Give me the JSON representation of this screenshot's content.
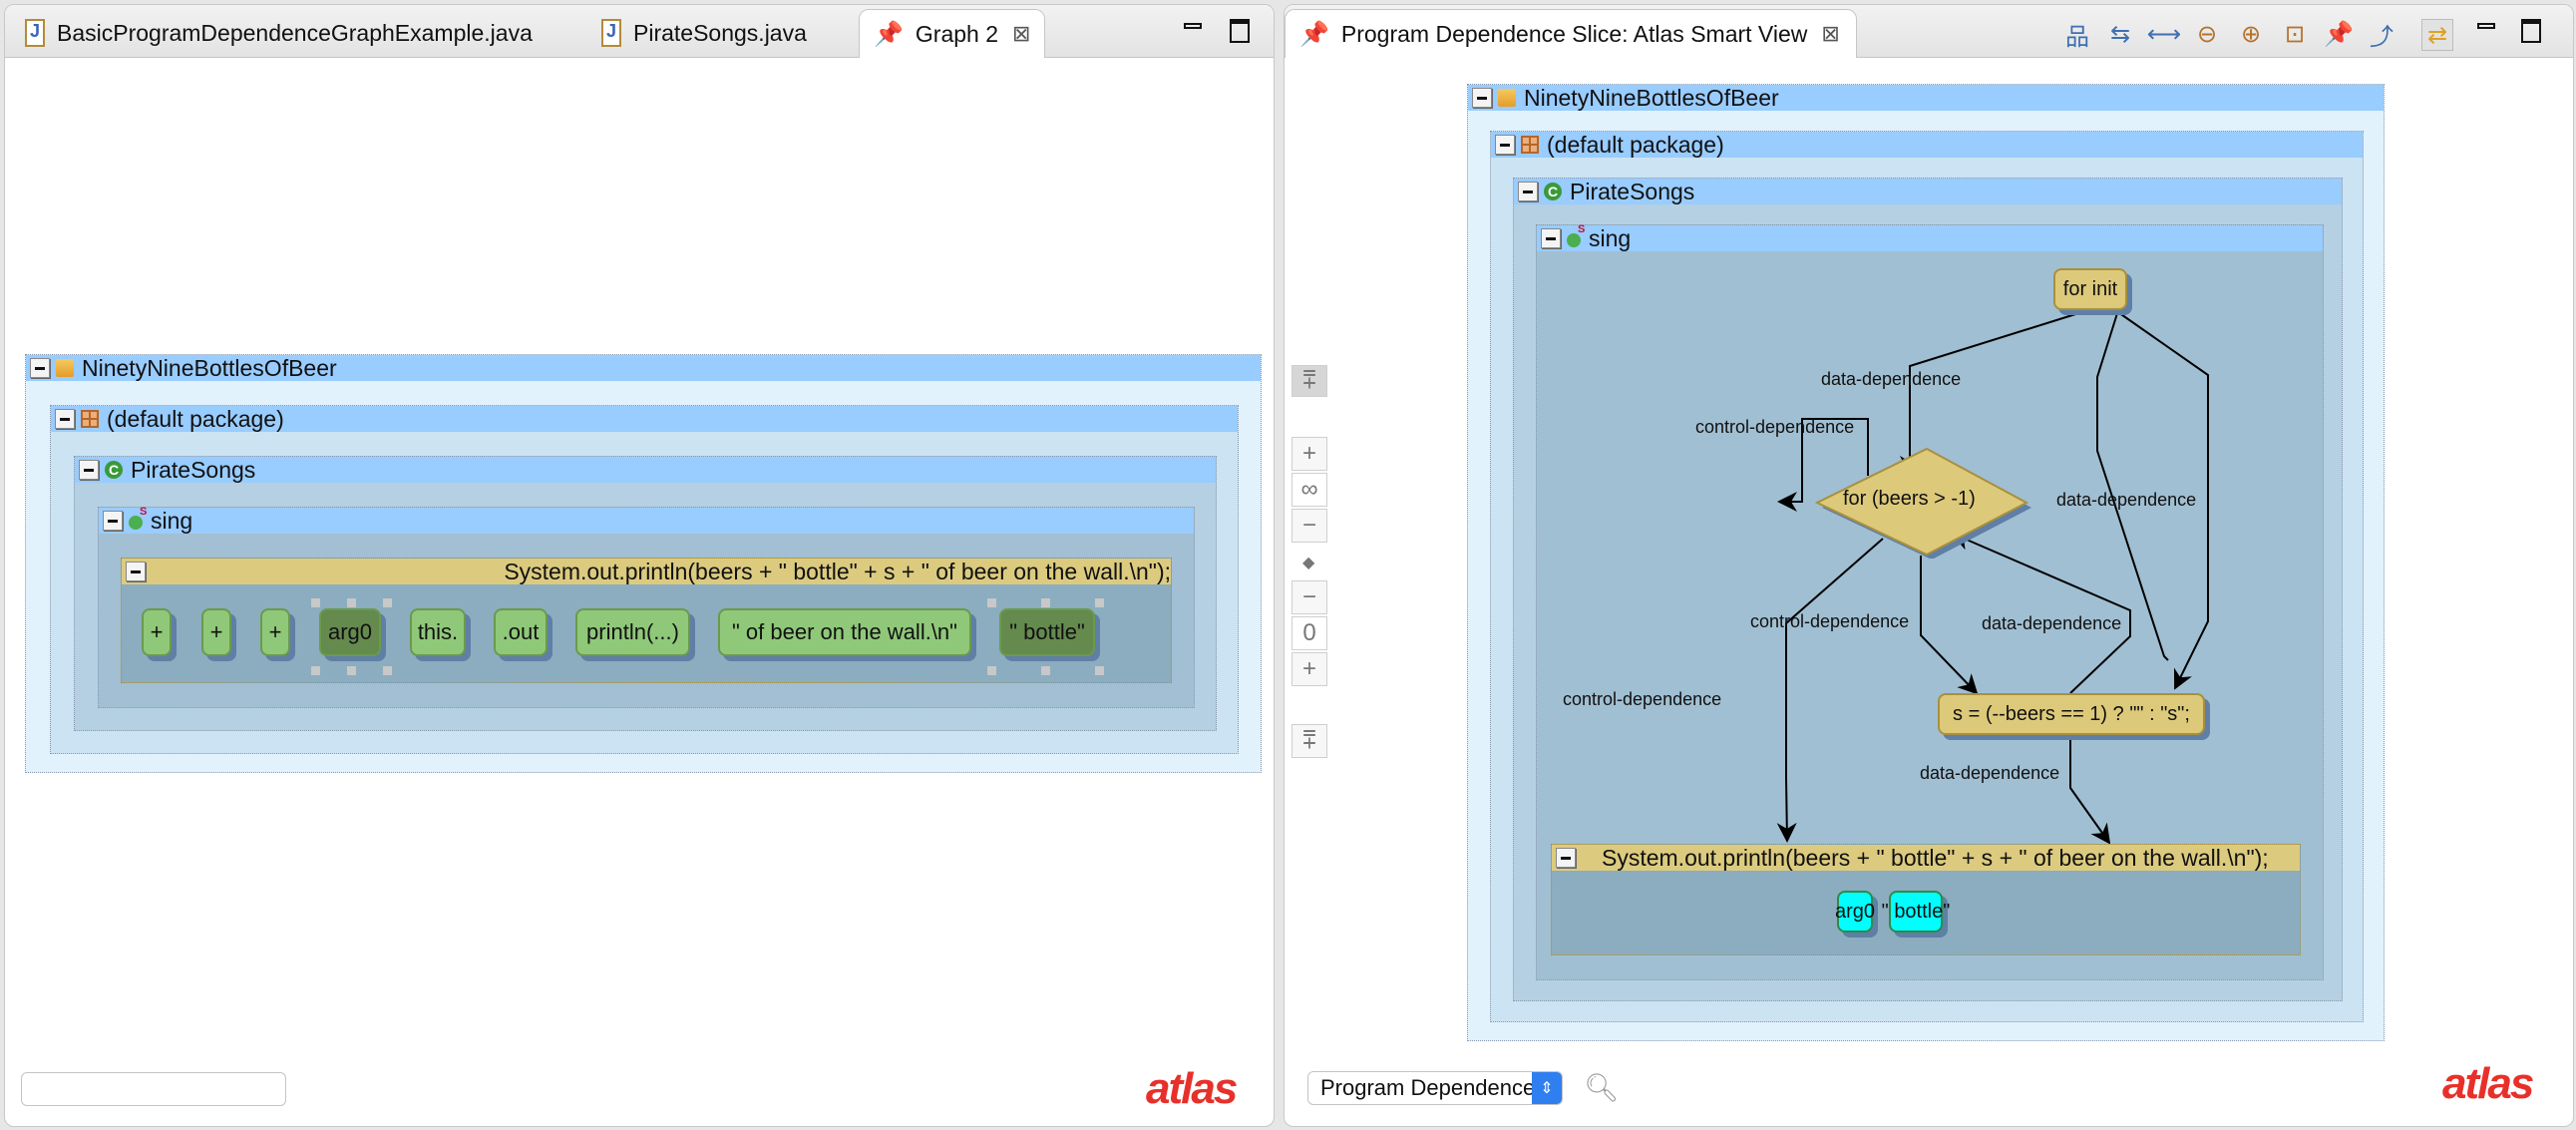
{
  "left_editor": {
    "tabs": [
      {
        "label": "BasicProgramDependenceGraphExample.java",
        "icon": "java-file-icon",
        "active": false
      },
      {
        "label": "PirateSongs.java",
        "icon": "java-file-icon",
        "active": false
      },
      {
        "label": "Graph 2",
        "icon": "pin-icon",
        "active": true,
        "closable": true
      }
    ],
    "graph": {
      "project": "NinetyNineBottlesOfBeer",
      "package": "(default package)",
      "class": "PirateSongs",
      "method": "sing",
      "statement": "System.out.println(beers + \" bottle\" + s + \" of beer on the wall.\\n\");",
      "nodes": [
        {
          "label": "+",
          "style": "light"
        },
        {
          "label": "+",
          "style": "light"
        },
        {
          "label": "+",
          "style": "light"
        },
        {
          "label": "arg0",
          "style": "dark",
          "selected": true
        },
        {
          "label": "this.",
          "style": "light"
        },
        {
          "label": ".out",
          "style": "light"
        },
        {
          "label": "println(...)",
          "style": "light"
        },
        {
          "label": "\" of beer on the wall.\\n\"",
          "style": "light"
        },
        {
          "label": "\" bottle\"",
          "style": "dark",
          "selected": true
        }
      ]
    },
    "search_input": {
      "value": "",
      "placeholder": ""
    },
    "logo": "atlas"
  },
  "right_view": {
    "tab": {
      "label": "Program Dependence Slice: Atlas Smart View",
      "icon": "pin-icon",
      "closable": true
    },
    "toolbar": [
      {
        "name": "hierarchical-layout",
        "icon": "tree-layout-icon"
      },
      {
        "name": "flow-layout",
        "icon": "flow-layout-icon"
      },
      {
        "name": "fit-width",
        "icon": "fit-width-icon"
      },
      {
        "name": "zoom-out",
        "icon": "zoom-out-icon"
      },
      {
        "name": "zoom-in",
        "icon": "zoom-in-icon"
      },
      {
        "name": "zoom-fit",
        "icon": "zoom-fit-icon"
      },
      {
        "name": "pin",
        "icon": "pin-icon"
      },
      {
        "name": "export",
        "icon": "export-icon"
      },
      {
        "name": "link-with-editor",
        "icon": "link-arrows-icon",
        "toggled": true
      }
    ],
    "depth_controls": {
      "forward": {
        "value": "∞"
      },
      "reverse": {
        "value": "0"
      }
    },
    "graph": {
      "project": "NinetyNineBottlesOfBeer",
      "package": "(default package)",
      "class": "PirateSongs",
      "method": "sing",
      "nodes": {
        "for_init": "for init",
        "for_cond": "for (beers > -1)",
        "assign": "s = (--beers == 1) ? \"\" : \"s\";",
        "statement": "System.out.println(beers + \" bottle\" + s + \" of beer on the wall.\\n\");",
        "arg0": "arg0",
        "bottle": "\" bottle\""
      },
      "edges": [
        {
          "from": "for_init",
          "to": "for_cond",
          "label": "data-dependence"
        },
        {
          "from": "for_cond",
          "to": "for_cond",
          "label": "control-dependence"
        },
        {
          "from": "for_init",
          "to": "assign",
          "label": "data-dependence"
        },
        {
          "from": "for_cond",
          "to": "assign",
          "label": "control-dependence"
        },
        {
          "from": "assign",
          "to": "for_cond",
          "label": "data-dependence"
        },
        {
          "from": "for_cond",
          "to": "statement",
          "label": "control-dependence"
        },
        {
          "from": "assign",
          "to": "statement",
          "label": "data-dependence"
        }
      ]
    },
    "analysis_select": {
      "value": "Program Dependence"
    },
    "logo": "atlas"
  }
}
